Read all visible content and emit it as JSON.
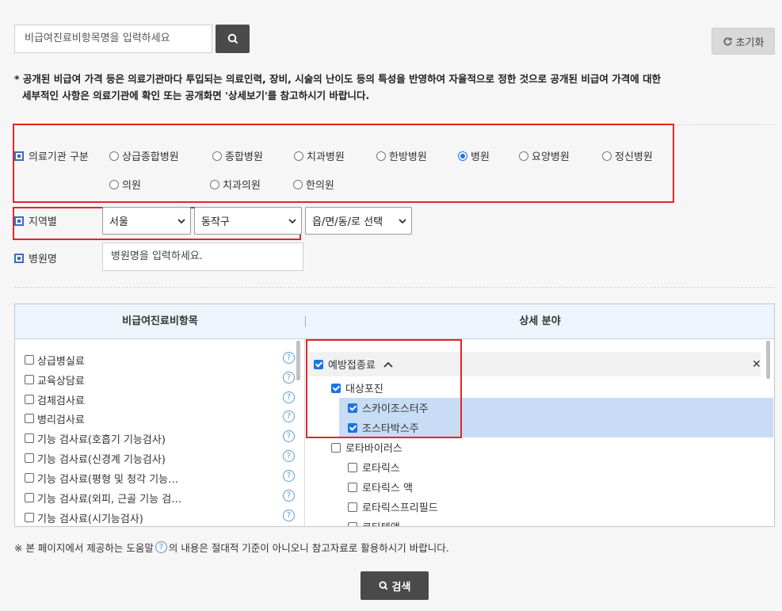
{
  "search": {
    "placeholder": "비급여진료비항목명을 입력하세요"
  },
  "reset_label": "초기화",
  "notice": {
    "line1": "* 공개된 비급여 가격 등은 의료기관마다 투입되는 의료인력, 장비, 시술의 난이도 등의 특성을 반영하여 자율적으로 정한 것으로 공개된 비급여 가격에 대한",
    "line2": "세부적인 사항은 의료기관에 확인 또는 공개화면 '상세보기'를 참고하시기 바랍니다."
  },
  "institution": {
    "label": "의료기관 구분",
    "options": [
      "상급종합병원",
      "종합병원",
      "치과병원",
      "한방병원",
      "병원",
      "요양병원",
      "정신병원",
      "의원",
      "치과의원",
      "한의원"
    ],
    "selected": "병원"
  },
  "region": {
    "label": "지역별",
    "city": "서울",
    "district": "동작구",
    "town": "읍/면/동/로 선택"
  },
  "hospital_name": {
    "label": "병원명",
    "placeholder": "병원명을 입력하세요."
  },
  "panel": {
    "left_header": "비급여진료비항목",
    "right_header": "상세 분야",
    "left_items": [
      "상급병실료",
      "교육상담료",
      "검체검사료",
      "병리검사료",
      "기능 검사료(호흡기 기능검사)",
      "기능 검사료(신경계 기능검사)",
      "기능 검사료(평형 및 청각 기능…",
      "기능 검사료(외피, 근골 기능 검…",
      "기능 검사료(시기능검사)"
    ],
    "help_glyph": "?",
    "right_tree": {
      "category": "예방접종료",
      "group1": "대상포진",
      "group1_items": [
        "스카이조스터주",
        "조스타박스주"
      ],
      "group2": "로타바이러스",
      "group2_items": [
        "로타릭스",
        "로타릭스 액",
        "로타릭스프리필드",
        "로타텍액"
      ]
    },
    "close_glyph": "✕"
  },
  "footer_note": {
    "before": "※ 본 페이지에서 제공하는 도움말",
    "after": "의 내용은 절대적 기준이 아니오니 참고자료로 활용하시기 바랍니다."
  },
  "submit_label": "검색",
  "colors": {
    "accent": "#1a73e8",
    "highlight_red": "#e0262b",
    "dark_button": "#4a4a4a"
  }
}
